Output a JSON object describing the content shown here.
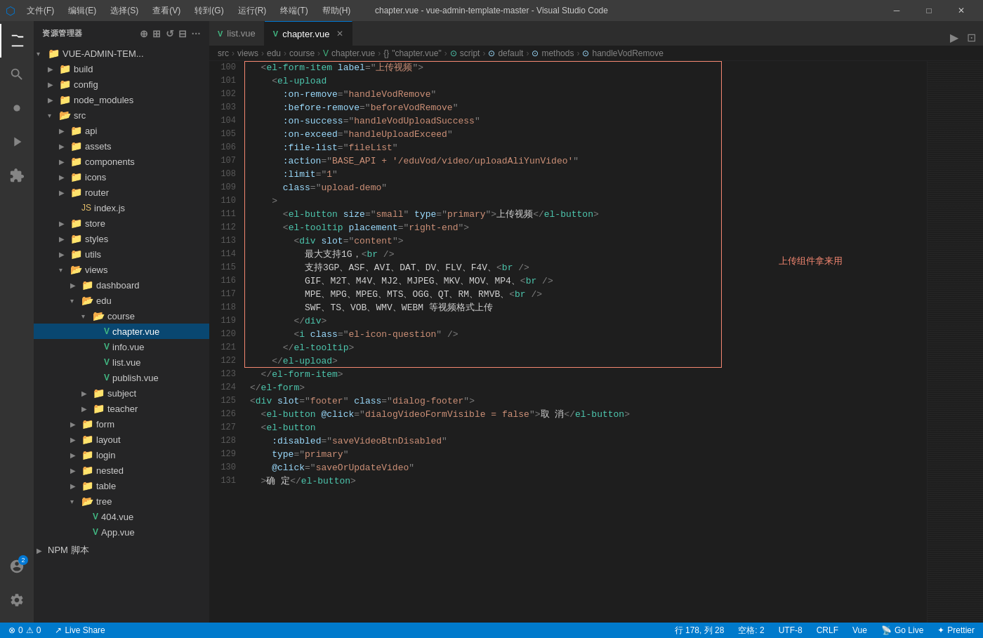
{
  "titleBar": {
    "icon": "⬡",
    "menus": [
      "文件(F)",
      "编辑(E)",
      "选择(S)",
      "查看(V)",
      "转到(G)",
      "运行(R)",
      "终端(T)",
      "帮助(H)"
    ],
    "title": "chapter.vue - vue-admin-template-master - Visual Studio Code",
    "minimize": "─",
    "maximize": "□",
    "close": "✕"
  },
  "activityBar": {
    "items": [
      {
        "icon": "⎘",
        "name": "source-control-icon",
        "label": "Source Control"
      },
      {
        "icon": "🔍",
        "name": "search-icon",
        "label": "Search"
      },
      {
        "icon": "⑂",
        "name": "scm-icon",
        "label": "SCM"
      },
      {
        "icon": "▶",
        "name": "run-icon",
        "label": "Run"
      },
      {
        "icon": "⊞",
        "name": "extensions-icon",
        "label": "Extensions"
      }
    ],
    "bottomItems": [
      {
        "icon": "👤",
        "name": "account-icon",
        "badge": "2"
      },
      {
        "icon": "⚙",
        "name": "settings-icon"
      }
    ]
  },
  "sidebar": {
    "title": "资源管理器",
    "rootLabel": "VUE-ADMIN-TEM...",
    "tree": [
      {
        "level": 1,
        "type": "folder",
        "label": "build",
        "open": false
      },
      {
        "level": 1,
        "type": "folder",
        "label": "config",
        "open": false
      },
      {
        "level": 1,
        "type": "folder",
        "label": "node_modules",
        "open": false
      },
      {
        "level": 1,
        "type": "folder",
        "label": "src",
        "open": true
      },
      {
        "level": 2,
        "type": "folder",
        "label": "api",
        "open": false
      },
      {
        "level": 2,
        "type": "folder",
        "label": "assets",
        "open": false
      },
      {
        "level": 2,
        "type": "folder",
        "label": "components",
        "open": false
      },
      {
        "level": 2,
        "type": "folder",
        "label": "icons",
        "open": false
      },
      {
        "level": 2,
        "type": "folder",
        "label": "router",
        "open": false
      },
      {
        "level": 3,
        "type": "js-file",
        "label": "index.js"
      },
      {
        "level": 2,
        "type": "folder",
        "label": "store",
        "open": false
      },
      {
        "level": 2,
        "type": "folder",
        "label": "styles",
        "open": false
      },
      {
        "level": 2,
        "type": "folder",
        "label": "utils",
        "open": false
      },
      {
        "level": 2,
        "type": "folder",
        "label": "views",
        "open": true
      },
      {
        "level": 3,
        "type": "folder",
        "label": "dashboard",
        "open": false
      },
      {
        "level": 3,
        "type": "folder",
        "label": "edu",
        "open": true
      },
      {
        "level": 4,
        "type": "folder",
        "label": "course",
        "open": true
      },
      {
        "level": 5,
        "type": "vue-file",
        "label": "chapter.vue",
        "active": true
      },
      {
        "level": 5,
        "type": "vue-file",
        "label": "info.vue"
      },
      {
        "level": 5,
        "type": "vue-file",
        "label": "list.vue"
      },
      {
        "level": 5,
        "type": "vue-file",
        "label": "publish.vue"
      },
      {
        "level": 4,
        "type": "folder",
        "label": "subject",
        "open": false
      },
      {
        "level": 4,
        "type": "folder",
        "label": "teacher",
        "open": false
      },
      {
        "level": 3,
        "type": "folder",
        "label": "form",
        "open": false
      },
      {
        "level": 3,
        "type": "folder",
        "label": "layout",
        "open": false
      },
      {
        "level": 3,
        "type": "folder",
        "label": "login",
        "open": false
      },
      {
        "level": 3,
        "type": "folder",
        "label": "nested",
        "open": false
      },
      {
        "level": 3,
        "type": "folder",
        "label": "table",
        "open": false
      },
      {
        "level": 3,
        "type": "folder",
        "label": "tree",
        "open": false
      },
      {
        "level": 4,
        "type": "vue-file",
        "label": "404.vue"
      },
      {
        "level": 4,
        "type": "vue-file",
        "label": "App.vue"
      }
    ],
    "npmSection": "NPM 脚本"
  },
  "tabs": [
    {
      "label": "list.vue",
      "icon": "V",
      "iconColor": "#42b883",
      "active": false,
      "closable": true
    },
    {
      "label": "chapter.vue",
      "icon": "V",
      "iconColor": "#42b883",
      "active": true,
      "closable": true
    }
  ],
  "breadcrumb": {
    "items": [
      "src",
      "views",
      "edu",
      "course",
      "chapter.vue",
      "{}",
      "\"chapter.vue\"",
      "script",
      "default",
      "methods",
      "handleVodRemove"
    ]
  },
  "codeLines": [
    {
      "num": 100,
      "content": "  <el-form-item label=\"上传视频\">"
    },
    {
      "num": 101,
      "content": "    <el-upload"
    },
    {
      "num": 102,
      "content": "      :on-remove=\"handleVodRemove\""
    },
    {
      "num": 103,
      "content": "      :before-remove=\"beforeVodRemove\""
    },
    {
      "num": 104,
      "content": "      :on-success=\"handleVodUploadSuccess\""
    },
    {
      "num": 105,
      "content": "      :on-exceed=\"handleUploadExceed\""
    },
    {
      "num": 106,
      "content": "      :file-list=\"fileList\""
    },
    {
      "num": 107,
      "content": "      :action=\"BASE_API + '/eduVod/video/uploadAliYunVideo'\""
    },
    {
      "num": 108,
      "content": "      :limit=\"1\""
    },
    {
      "num": 109,
      "content": "      class=\"upload-demo\""
    },
    {
      "num": 110,
      "content": "    >"
    },
    {
      "num": 111,
      "content": "      <el-button size=\"small\" type=\"primary\">上传视频</el-button>"
    },
    {
      "num": 112,
      "content": "      <el-tooltip placement=\"right-end\">"
    },
    {
      "num": 113,
      "content": "        <div slot=\"content\">"
    },
    {
      "num": 114,
      "content": "          最大支持1G，<br />"
    },
    {
      "num": 115,
      "content": "          支持3GP、ASF、AVI、DAT、DV、FLV、F4V、<br />"
    },
    {
      "num": 116,
      "content": "          GIF、M2T、M4V、MJ2、MJPEG、MKV、MOV、MP4、<br />"
    },
    {
      "num": 117,
      "content": "          MPE、MPG、MPEG、MTS、OGG、QT、RM、RMVB、<br />"
    },
    {
      "num": 118,
      "content": "          SWF、TS、VOB、WMV、WEBM 等视频格式上传"
    },
    {
      "num": 119,
      "content": "        </div>"
    },
    {
      "num": 120,
      "content": "        <i class=\"el-icon-question\" />"
    },
    {
      "num": 121,
      "content": "      </el-tooltip>"
    },
    {
      "num": 122,
      "content": "    </el-upload>"
    },
    {
      "num": 123,
      "content": "  </el-form-item>"
    },
    {
      "num": 124,
      "content": "</el-form>"
    },
    {
      "num": 125,
      "content": "<div slot=\"footer\" class=\"dialog-footer\">"
    },
    {
      "num": 126,
      "content": "  <el-button @click=\"dialogVideoFormVisible = false\">取 消</el-button>"
    },
    {
      "num": 127,
      "content": "  <el-button"
    },
    {
      "num": 128,
      "content": "    :disabled=\"saveVideoBtnDisabled\""
    },
    {
      "num": 129,
      "content": "    type=\"primary\""
    },
    {
      "num": 130,
      "content": "    @click=\"saveOrUpdateVideo\""
    },
    {
      "num": 131,
      "content": "  >确 定</el-button>"
    }
  ],
  "annotation": "上传组件拿来用",
  "statusBar": {
    "errors": "0",
    "warnings": "0",
    "liveShare": "Live Share",
    "position": "行 178, 列 28",
    "spaces": "空格: 2",
    "encoding": "UTF-8",
    "lineEnding": "CRLF",
    "language": "Vue",
    "goLive": "Go Live",
    "prettier": "Prettier"
  }
}
